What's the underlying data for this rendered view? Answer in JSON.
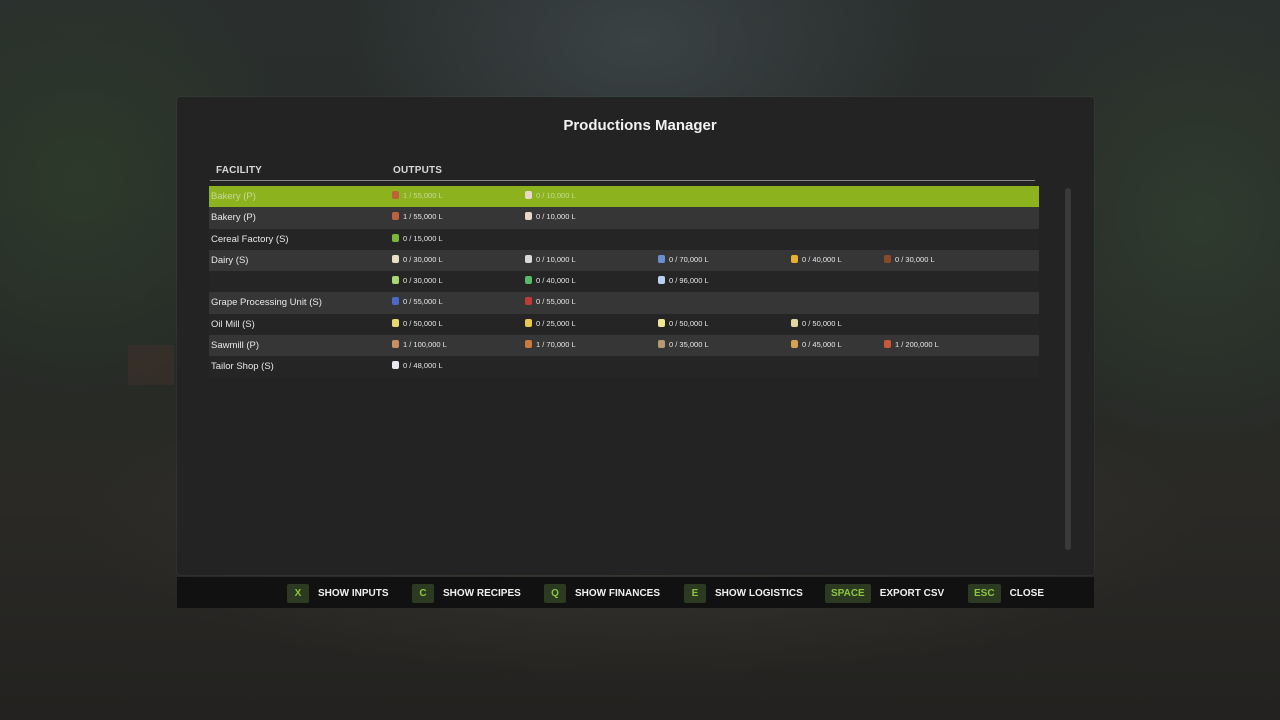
{
  "title": "Productions Manager",
  "columns": {
    "facility": "FACILITY",
    "outputs": "OUTPUTS"
  },
  "rows": [
    {
      "facility": "Bakery (P)",
      "selected": true,
      "outputs": [
        {
          "text": "1 / 55,000 L",
          "icon": "bread-icon",
          "color": "#c0603a"
        },
        {
          "text": "0 / 10,000 L",
          "icon": "cake-icon",
          "color": "#e8d8c8"
        }
      ]
    },
    {
      "facility": "Bakery (P)",
      "outputs": [
        {
          "text": "1 / 55,000 L",
          "icon": "bread-icon",
          "color": "#c0603a"
        },
        {
          "text": "0 / 10,000 L",
          "icon": "cake-icon",
          "color": "#e8d8c8"
        }
      ]
    },
    {
      "facility": "Cereal Factory (S)",
      "outputs": [
        {
          "text": "0 / 15,000 L",
          "icon": "cereal-icon",
          "color": "#7ab83a"
        }
      ]
    },
    {
      "facility": "Dairy (S)",
      "outputs": [
        {
          "text": "0 / 30,000 L",
          "icon": "milk-bottle-icon",
          "color": "#e8e0c0"
        },
        {
          "text": "0 / 10,000 L",
          "icon": "cheese-icon",
          "color": "#d8d8d8"
        },
        {
          "text": "0 / 70,000 L",
          "icon": "butter-icon",
          "color": "#6a8fd0"
        },
        {
          "text": "0 / 40,000 L",
          "icon": "cheese-wedge-icon",
          "color": "#e8b030"
        },
        {
          "text": "0 / 30,000 L",
          "icon": "chocolate-icon",
          "color": "#8a4a2a"
        }
      ]
    },
    {
      "facility": "",
      "outputs": [
        {
          "text": "0 / 30,000 L",
          "icon": "yogurt-icon",
          "color": "#a8d870"
        },
        {
          "text": "0 / 40,000 L",
          "icon": "herb-icon",
          "color": "#5ab86a"
        },
        {
          "text": "0 / 96,000 L",
          "icon": "milk-carton-icon",
          "color": "#b8d0f0"
        }
      ]
    },
    {
      "facility": "Grape Processing Unit (S)",
      "outputs": [
        {
          "text": "0 / 55,000 L",
          "icon": "juice-icon",
          "color": "#4a6ac8"
        },
        {
          "text": "0 / 55,000 L",
          "icon": "raisin-icon",
          "color": "#c03a3a"
        }
      ]
    },
    {
      "facility": "Oil Mill (S)",
      "outputs": [
        {
          "text": "0 / 50,000 L",
          "icon": "oil-bottle-icon",
          "color": "#e8d870"
        },
        {
          "text": "0 / 25,000 L",
          "icon": "oil-bottle-icon",
          "color": "#e8c850"
        },
        {
          "text": "0 / 50,000 L",
          "icon": "oil-bottle-icon",
          "color": "#f0e890"
        },
        {
          "text": "0 / 50,000 L",
          "icon": "oil-bottle-icon",
          "color": "#e0d8a0"
        }
      ]
    },
    {
      "facility": "Sawmill (P)",
      "outputs": [
        {
          "text": "1 / 100,000 L",
          "icon": "planks-icon",
          "color": "#c89060"
        },
        {
          "text": "1 / 70,000 L",
          "icon": "wood-beam-icon",
          "color": "#c87a40"
        },
        {
          "text": "0 / 35,000 L",
          "icon": "furniture-icon",
          "color": "#b89a70"
        },
        {
          "text": "0 / 45,000 L",
          "icon": "log-icon",
          "color": "#d8a050"
        },
        {
          "text": "1 / 200,000 L",
          "icon": "woodchips-icon",
          "color": "#c85a3a"
        }
      ]
    },
    {
      "facility": "Tailor Shop (S)",
      "outputs": [
        {
          "text": "0 / 48,000 L",
          "icon": "clothes-icon",
          "color": "#e8e8f0"
        }
      ]
    }
  ],
  "footer": [
    {
      "key": "X",
      "label": "SHOW INPUTS"
    },
    {
      "key": "C",
      "label": "SHOW RECIPES"
    },
    {
      "key": "Q",
      "label": "SHOW FINANCES"
    },
    {
      "key": "E",
      "label": "SHOW LOGISTICS"
    },
    {
      "key": "SPACE",
      "label": "EXPORT CSV"
    },
    {
      "key": "ESC",
      "label": "CLOSE"
    }
  ]
}
